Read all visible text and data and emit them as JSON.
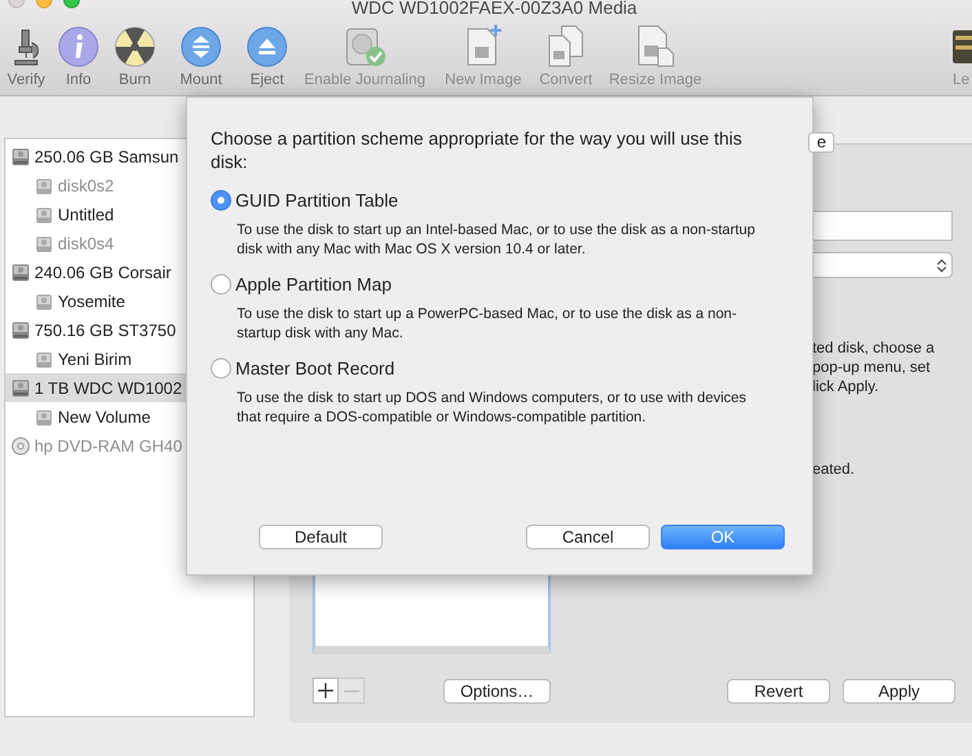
{
  "window": {
    "title": "WDC WD1002FAEX-00Z3A0 Media"
  },
  "toolbar": [
    {
      "kind": "verify",
      "label": "Verify"
    },
    {
      "kind": "info",
      "label": "Info"
    },
    {
      "kind": "burn",
      "label": "Burn"
    },
    {
      "kind": "mount",
      "label": "Mount"
    },
    {
      "kind": "eject",
      "label": "Eject"
    },
    {
      "kind": "journal",
      "label": "Enable Journaling"
    },
    {
      "kind": "new-image",
      "label": "New Image"
    },
    {
      "kind": "convert",
      "label": "Convert"
    },
    {
      "kind": "resize",
      "label": "Resize Image"
    },
    {
      "kind": "log",
      "label": "Le"
    }
  ],
  "sidebar": {
    "items": [
      {
        "kind": "disk",
        "label": "250.06 GB Samsun",
        "selected": false,
        "dimmed": false,
        "children": [
          {
            "kind": "volume",
            "label": "disk0s2",
            "selected": false,
            "dimmed": true
          },
          {
            "kind": "volume",
            "label": "Untitled",
            "selected": false,
            "dimmed": false
          },
          {
            "kind": "volume",
            "label": "disk0s4",
            "selected": false,
            "dimmed": true
          }
        ]
      },
      {
        "kind": "disk",
        "label": "240.06 GB Corsair",
        "selected": false,
        "dimmed": false,
        "children": [
          {
            "kind": "volume",
            "label": "Yosemite",
            "selected": false,
            "dimmed": false
          }
        ]
      },
      {
        "kind": "disk",
        "label": "750.16 GB ST3750",
        "selected": false,
        "dimmed": false,
        "children": [
          {
            "kind": "volume",
            "label": "Yeni Birim",
            "selected": false,
            "dimmed": false
          }
        ]
      },
      {
        "kind": "disk",
        "label": "1 TB WDC WD1002",
        "selected": true,
        "dimmed": false,
        "children": [
          {
            "kind": "volume",
            "label": "New Volume",
            "selected": false,
            "dimmed": false
          }
        ]
      },
      {
        "kind": "optical",
        "label": "hp DVD-RAM GH40",
        "selected": false,
        "dimmed": true
      }
    ]
  },
  "main": {
    "tab_label": "e",
    "instructions": [
      "ted disk, choose a",
      "pop-up menu, set",
      "lick Apply."
    ],
    "note": "eated.",
    "options_button": "Options…",
    "buttons": [
      "Revert",
      "Apply"
    ]
  },
  "sheet": {
    "prompt": "Choose a partition scheme appropriate for the way you will use this disk:",
    "schemes": [
      {
        "label": "GUID Partition Table",
        "description": "To use the disk to start up an Intel-based Mac, or to use the disk as a non-startup disk with any Mac with Mac OS X version 10.4 or later.",
        "selected": true
      },
      {
        "label": "Apple Partition Map",
        "description": "To use the disk to start up a PowerPC-based Mac, or to use the disk as a non-startup disk with any Mac.",
        "selected": false
      },
      {
        "label": "Master Boot Record",
        "description": "To use the disk to start up DOS and Windows computers, or to use with devices that require a DOS-compatible or Windows-compatible partition.",
        "selected": false
      }
    ],
    "buttons": [
      {
        "kind": "secondary",
        "label": "Default"
      },
      {
        "kind": "plain",
        "label": "Cancel"
      },
      {
        "kind": "primary",
        "label": "OK"
      }
    ]
  }
}
